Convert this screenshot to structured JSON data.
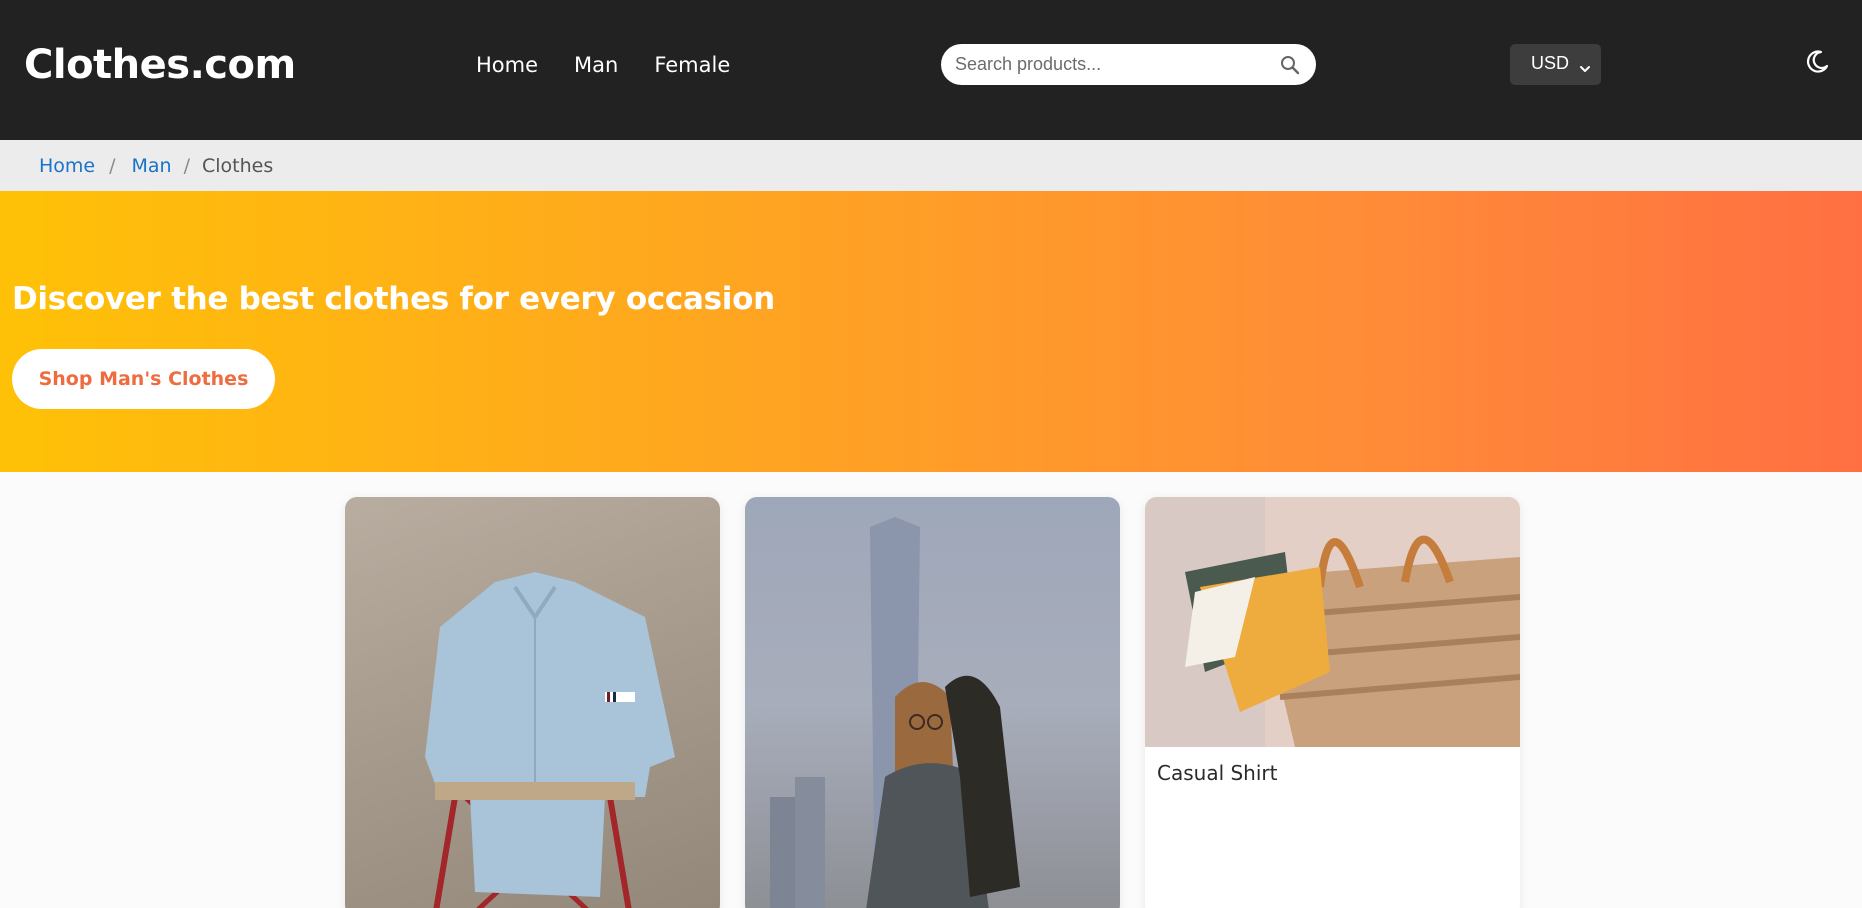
{
  "header": {
    "logo": "Clothes.com",
    "nav": [
      {
        "label": "Home"
      },
      {
        "label": "Man"
      },
      {
        "label": "Female"
      }
    ],
    "search": {
      "placeholder": "Search products...",
      "value": ""
    },
    "currency": {
      "selected": "USD"
    },
    "theme_icon": "moon-icon"
  },
  "breadcrumb": {
    "items": [
      {
        "label": "Home"
      },
      {
        "label": "Man"
      }
    ],
    "current": "Clothes"
  },
  "hero": {
    "heading": "Discover the best clothes for every occasion",
    "cta_label": "Shop Man's Clothes"
  },
  "products": [
    {
      "title": ""
    },
    {
      "title": ""
    },
    {
      "title": "Casual Shirt"
    }
  ],
  "colors": {
    "header_bg": "#222222",
    "breadcrumb_bg": "#ececec",
    "link": "#1a73c8",
    "hero_start": "#ffc107",
    "hero_end": "#ff6f42",
    "cta_text": "#ee6c3f"
  }
}
